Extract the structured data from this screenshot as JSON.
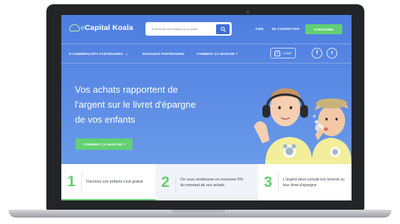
{
  "header": {
    "logo_prefix": "e",
    "logo_name": "Capital Koala",
    "search_placeholder": "Je recherche une enseigne ou un produit",
    "help_label": "AIDE",
    "login_label": "SE CONNECTER",
    "join_label": "S'INSCRIRE"
  },
  "subnav": {
    "partners_label": "E-COMMERÇANTS PARTENAIRES",
    "stores_label": "MAGASINS PARTENAIRES",
    "how_label": "COMMENT ÇA MARCHE ?",
    "likes_label": "J'AIME",
    "facebook_glyph": "f",
    "twitter_glyph": "t"
  },
  "hero": {
    "headline_line1": "Vos achats rapportent de",
    "headline_line2": "l'argent sur le livret d'épargne",
    "headline_line3": "de vos enfants",
    "cta_label": "COMMENT ÇA MARCHE ?"
  },
  "steps": [
    {
      "num": "1",
      "text": "Inscrivez vos enfants c'est gratuit"
    },
    {
      "num": "2",
      "text_line1": "On vous rembourse en moyenne 5%",
      "text_line2": "du montant de vos achats"
    },
    {
      "num": "3",
      "text_line1": "L'argent ainsi cumulé est reversé su",
      "text_line2": "leur livret d'épargne"
    }
  ],
  "colors": {
    "hero_blue": "#4d7ddf",
    "accent_green": "#62d072",
    "laptop_frame": "#222428"
  },
  "icons": [
    "search-icon",
    "chevron-down-icon",
    "heart-icon",
    "facebook-icon",
    "twitter-icon",
    "logo-koala-icon"
  ]
}
